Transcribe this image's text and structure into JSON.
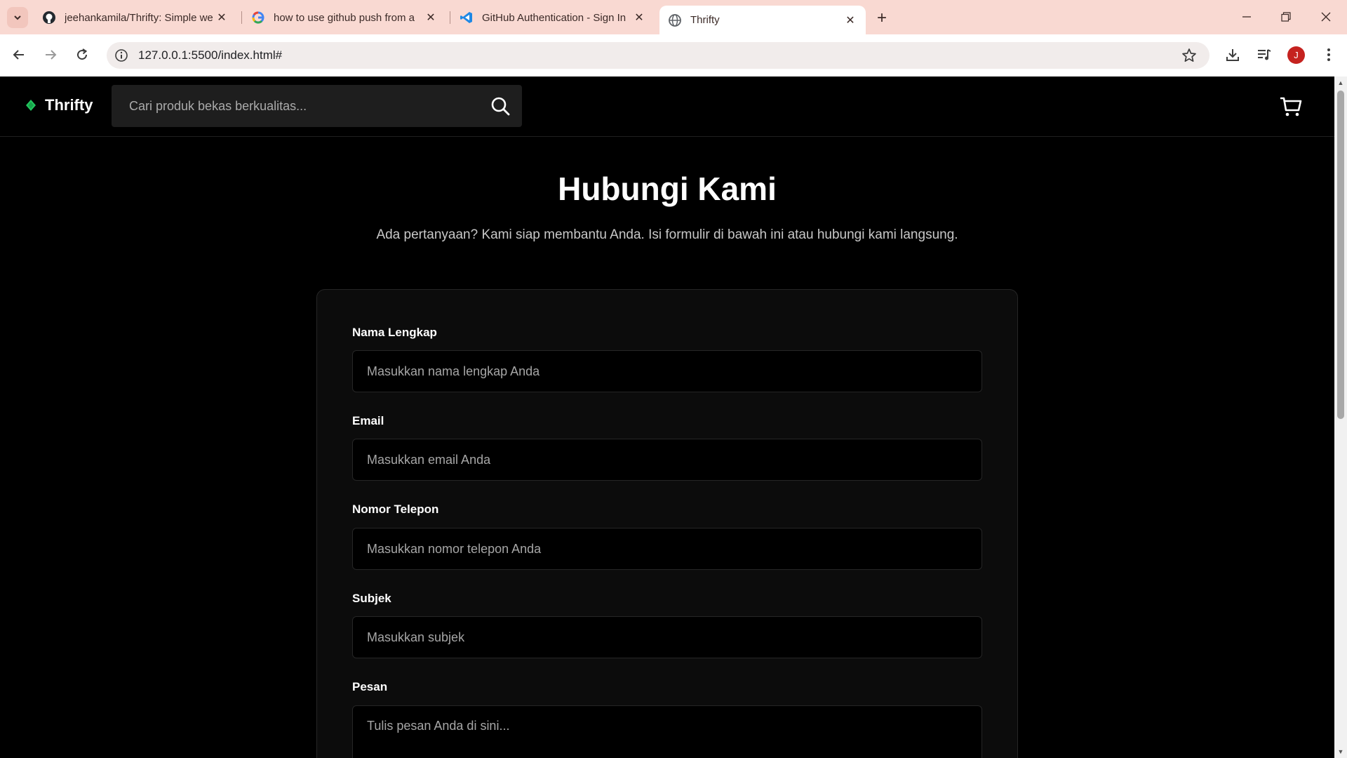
{
  "browser": {
    "tabs": [
      {
        "title": "jeehankamila/Thrifty: Simple we",
        "icon": "github-icon"
      },
      {
        "title": "how to use github push from a",
        "icon": "google-icon"
      },
      {
        "title": "GitHub Authentication - Sign In",
        "icon": "vscode-icon"
      },
      {
        "title": "Thrifty",
        "icon": "globe-icon",
        "active": true
      }
    ],
    "url": "127.0.0.1:5500/index.html#",
    "profile_initial": "J"
  },
  "site": {
    "brand": "Thrifty",
    "search_placeholder": "Cari produk bekas berkualitas...",
    "accent_color": "#22c55e"
  },
  "contact": {
    "title": "Hubungi Kami",
    "subtitle": "Ada pertanyaan? Kami siap membantu Anda. Isi formulir di bawah ini atau hubungi kami langsung.",
    "fields": [
      {
        "label": "Nama Lengkap",
        "placeholder": "Masukkan nama lengkap Anda"
      },
      {
        "label": "Email",
        "placeholder": "Masukkan email Anda"
      },
      {
        "label": "Nomor Telepon",
        "placeholder": "Masukkan nomor telepon Anda"
      },
      {
        "label": "Subjek",
        "placeholder": "Masukkan subjek"
      },
      {
        "label": "Pesan",
        "placeholder": "Tulis pesan Anda di sini..."
      }
    ]
  }
}
